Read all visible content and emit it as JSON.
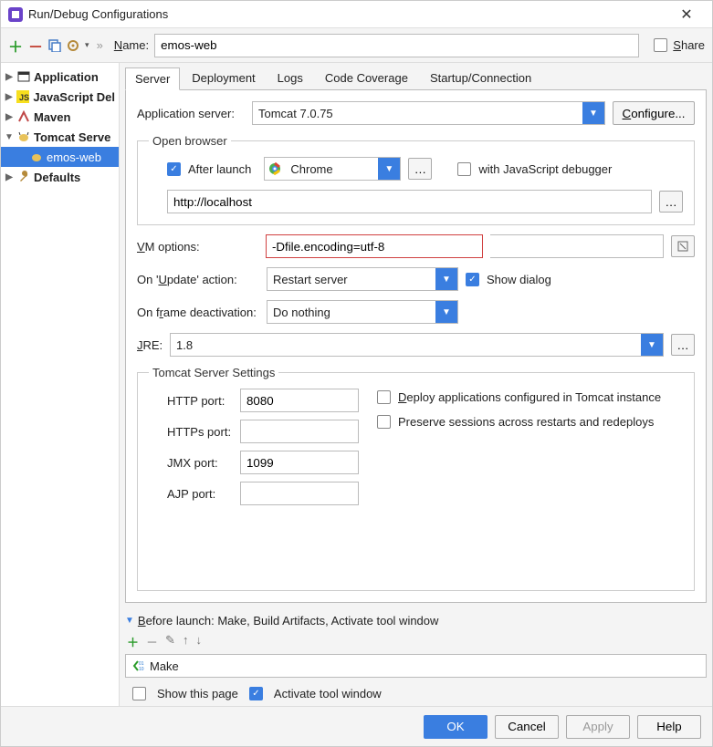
{
  "window": {
    "title": "Run/Debug Configurations"
  },
  "topbar": {
    "name_label": "Name:",
    "name_value": "emos-web",
    "share_label": "Share"
  },
  "tree": {
    "items": [
      {
        "label": "Application",
        "bold": true
      },
      {
        "label": "JavaScript Del",
        "bold": true
      },
      {
        "label": "Maven",
        "bold": true
      },
      {
        "label": "Tomcat Serve",
        "bold": true,
        "expanded": true
      },
      {
        "label": "emos-web",
        "selected": true,
        "indent": 2
      },
      {
        "label": "Defaults",
        "bold": true
      }
    ]
  },
  "tabs": [
    "Server",
    "Deployment",
    "Logs",
    "Code Coverage",
    "Startup/Connection"
  ],
  "active_tab": 0,
  "server": {
    "app_server_label": "Application server:",
    "app_server_value": "Tomcat 7.0.75",
    "configure_btn": "Configure...",
    "open_browser_legend": "Open browser",
    "after_launch_label": "After launch",
    "browser_value": "Chrome",
    "js_debug_label": "with JavaScript debugger",
    "url_value": "http://localhost",
    "vm_label": "VM options:",
    "vm_value": "-Dfile.encoding=utf-8",
    "update_label": "On 'Update' action:",
    "update_value": "Restart server",
    "show_dialog_label": "Show dialog",
    "frame_label": "On frame deactivation:",
    "frame_value": "Do nothing",
    "jre_label": "JRE:",
    "jre_value": "1.8",
    "tomcat_settings_legend": "Tomcat Server Settings",
    "http_port_label": "HTTP port:",
    "http_port_value": "8080",
    "https_port_label": "HTTPs port:",
    "https_port_value": "",
    "jmx_port_label": "JMX port:",
    "jmx_port_value": "1099",
    "ajp_port_label": "AJP port:",
    "ajp_port_value": "",
    "deploy_label": "Deploy applications configured in Tomcat instance",
    "preserve_label": "Preserve sessions across restarts and redeploys"
  },
  "before_launch": {
    "header": "Before launch: Make, Build Artifacts, Activate tool window",
    "item": "Make",
    "show_page_label": "Show this page",
    "activate_label": "Activate tool window"
  },
  "footer": {
    "ok": "OK",
    "cancel": "Cancel",
    "apply": "Apply",
    "help": "Help"
  }
}
